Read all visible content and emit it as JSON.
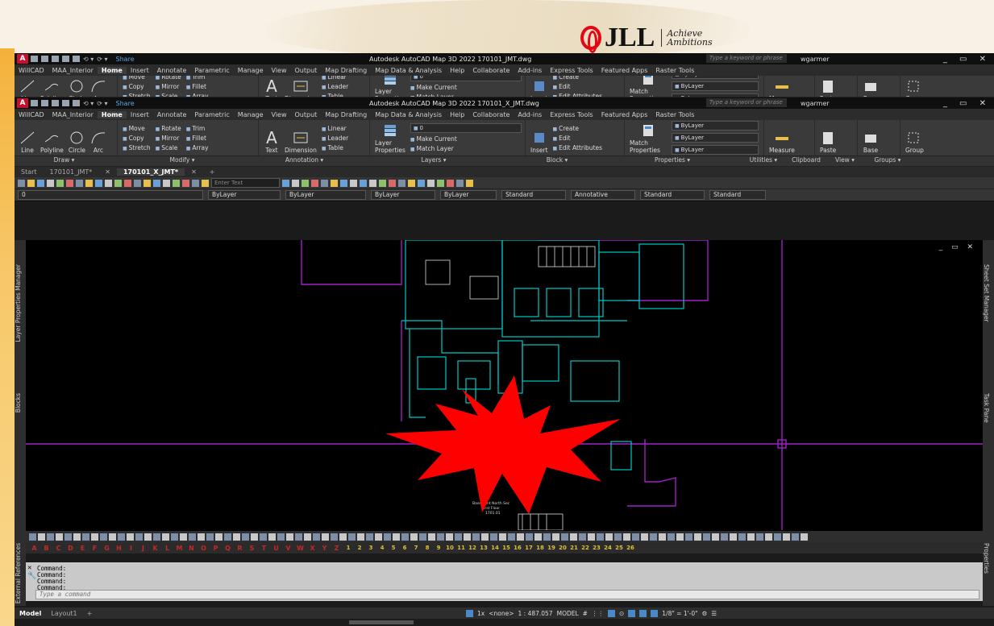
{
  "brand": {
    "name": "JLL",
    "tagline": "Achieve Ambitions"
  },
  "window": {
    "title": "Autodesk AutoCAD Map 3D 2022   170101_X_JMT.dwg",
    "first_title": "Autodesk AutoCAD Map 3D 2022   170101_JMT.dwg",
    "search_placeholder": "Type a keyword or phrase",
    "user": "wgarmer",
    "share": "Share"
  },
  "ribbon_tabs": [
    "WillCAD",
    "MAA_Interior",
    "Home",
    "Insert",
    "Annotate",
    "Parametric",
    "Manage",
    "View",
    "Output",
    "Map Drafting",
    "Map Data & Analysis",
    "Help",
    "Collaborate",
    "Add-ins",
    "Express Tools",
    "Featured Apps",
    "Raster Tools"
  ],
  "ribbon": {
    "draw": [
      "Line",
      "Polyline",
      "Circle",
      "Arc"
    ],
    "modify_col1": [
      "Move",
      "Copy",
      "Stretch"
    ],
    "modify_col2": [
      "Rotate",
      "Mirror",
      "Scale"
    ],
    "modify_col3": [
      "Trim",
      "Fillet",
      "Array"
    ],
    "annotation_text": "Text",
    "annotation_dim": "Dimension",
    "annotation_col": [
      "Linear",
      "Leader",
      "Table"
    ],
    "layer_props": "Layer Properties",
    "layer_value": "0",
    "layer_actions": [
      "Make Current",
      "Match Layer"
    ],
    "insert": "Insert",
    "block_col": [
      "Create",
      "Edit",
      "Edit Attributes"
    ],
    "match": "Match Properties",
    "prop_combos": [
      "ByLayer",
      "ByLayer",
      "ByLayer"
    ],
    "measure": "Measure",
    "paste": "Paste",
    "base": "Base",
    "group": "Group"
  },
  "panel_labels": [
    "Draw ▾",
    "Modify ▾",
    "Annotation ▾",
    "Layers ▾",
    "Block ▾",
    "Properties ▾",
    "Utilities ▾",
    "Clipboard",
    "View ▾",
    "Groups ▾"
  ],
  "doc_tabs": [
    "Start",
    "170101_JMT*",
    "170101_X_JMT*",
    "+"
  ],
  "toolbar": {
    "enter_text": "Enter Text"
  },
  "propbar": {
    "layer": "0",
    "color": "ByLayer",
    "linetype": "ByLayer",
    "lineweight": "ByLayer",
    "plotstyle": "ByLayer",
    "textstyle": "Standard",
    "annoscale": "Annotative",
    "tablestyle": "Standard",
    "mleaderstyle": "Standard"
  },
  "palettes": {
    "left": [
      "Layer Properties Manager",
      "Blocks",
      "External References"
    ],
    "right": [
      "Sheet Set Manager",
      "Task Pane",
      "Properties"
    ]
  },
  "drawing": {
    "caption_lines": [
      "Basement North Sec",
      "First Floor",
      "1701.01"
    ]
  },
  "letters": [
    "A",
    "B",
    "C",
    "D",
    "E",
    "F",
    "G",
    "H",
    "I",
    "J",
    "K",
    "L",
    "M",
    "N",
    "O",
    "P",
    "Q",
    "R",
    "S",
    "T",
    "U",
    "V",
    "W",
    "X",
    "Y",
    "Z"
  ],
  "numbers": [
    "1",
    "2",
    "3",
    "4",
    "5",
    "6",
    "7",
    "8",
    "9",
    "10",
    "11",
    "12",
    "13",
    "14",
    "15",
    "16",
    "17",
    "18",
    "19",
    "20",
    "21",
    "22",
    "23",
    "24",
    "25",
    "26"
  ],
  "command": {
    "history": [
      "Command:",
      "Command:",
      "Command:",
      "Command:"
    ],
    "placeholder": "Type a command"
  },
  "layout_tabs": [
    "Model",
    "Layout1",
    "+"
  ],
  "status": {
    "annoscale": "1x",
    "none": "<none>",
    "scale": "1 : 487.057",
    "model": "MODEL",
    "units": "1/8\" = 1'-0\""
  },
  "colors": {
    "walls": "#00c8c8",
    "purple": "#a020c8",
    "burst": "#ff0000",
    "accent": "#c8102e"
  }
}
